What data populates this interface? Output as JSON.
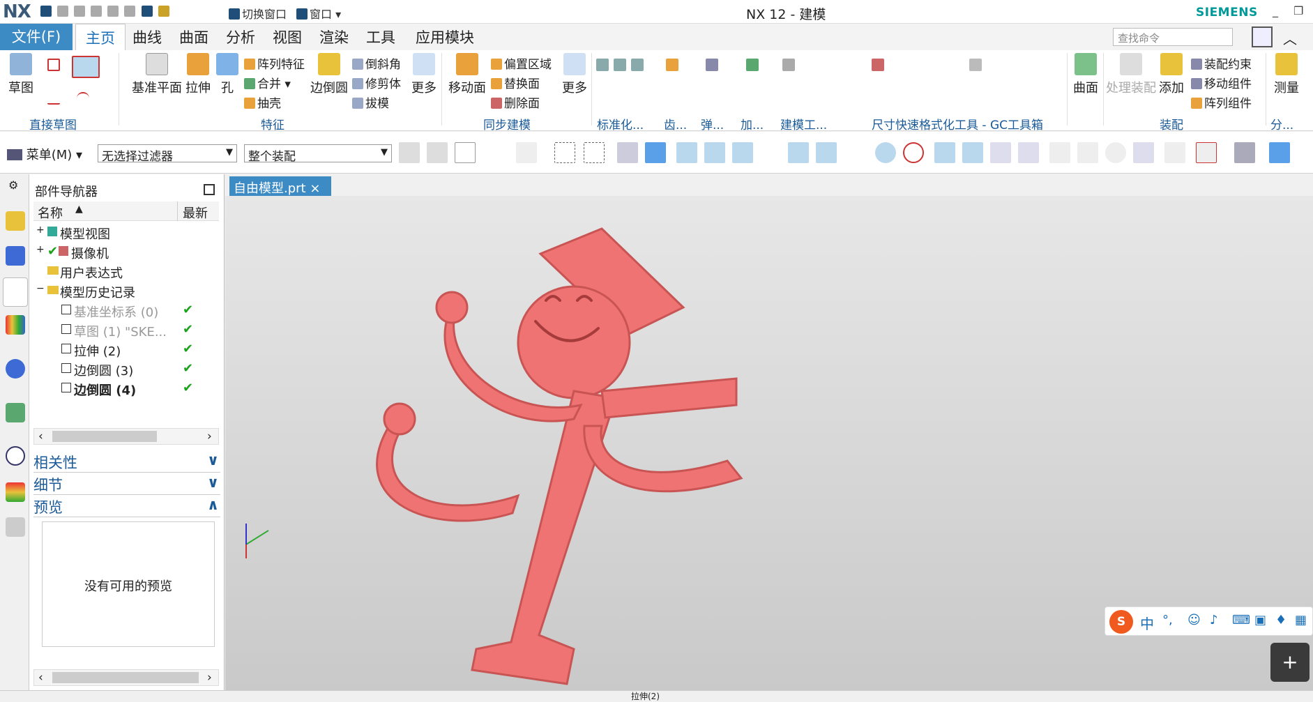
{
  "app": {
    "logo": "NX",
    "title": "NX 12 - 建模",
    "vendor": "SIEMENS"
  },
  "quick_access": {
    "switch_window": "切换窗口",
    "window": "窗口"
  },
  "tabs": {
    "file": "文件(F)",
    "items": [
      "主页",
      "曲线",
      "曲面",
      "分析",
      "视图",
      "渲染",
      "工具",
      "应用模块"
    ],
    "active": "主页"
  },
  "search": {
    "placeholder": "查找命令"
  },
  "ribbon": {
    "sketch": "草图",
    "groups": [
      "直接草图",
      "特征",
      "同步建模",
      "标准化...",
      "齿...",
      "弹...",
      "加...",
      "建模工...",
      "尺寸快速格式化工具 - GC工具箱",
      "装配",
      "分..."
    ],
    "feature": {
      "datum_plane": "基准平面",
      "extrude": "拉伸",
      "hole": "孔",
      "pattern": "阵列特征",
      "unite": "合并",
      "shell": "抽壳",
      "edge_blend": "边倒圆",
      "chamfer": "倒斜角",
      "trim": "修剪体",
      "draft": "拔模",
      "more": "更多"
    },
    "sync": {
      "move_face": "移动面",
      "offset_region": "偏置区域",
      "replace_face": "替换面",
      "delete_face": "删除面",
      "more": "更多"
    },
    "surface": "曲面",
    "assembly": {
      "process": "处理装配",
      "add": "添加",
      "constraint": "装配约束",
      "move_comp": "移动组件",
      "pattern_comp": "阵列组件",
      "measure": "测量"
    }
  },
  "toolbar2": {
    "menu": "菜单(M)",
    "filter": "无选择过滤器",
    "scope": "整个装配"
  },
  "navigator": {
    "title": "部件导航器",
    "col_name": "名称",
    "col_latest": "最新",
    "rows": [
      {
        "label": "模型视图",
        "dim": false,
        "check": ""
      },
      {
        "label": "摄像机",
        "dim": false,
        "check": ""
      },
      {
        "label": "用户表达式",
        "dim": false,
        "check": ""
      },
      {
        "label": "模型历史记录",
        "dim": false,
        "check": ""
      },
      {
        "label": "基准坐标系 (0)",
        "dim": true,
        "check": "✔"
      },
      {
        "label": "草图 (1) \"SKE...",
        "dim": true,
        "check": "✔"
      },
      {
        "label": "拉伸 (2)",
        "dim": false,
        "check": "✔"
      },
      {
        "label": "边倒圆 (3)",
        "dim": false,
        "check": "✔"
      },
      {
        "label": "边倒圆 (4)",
        "dim": false,
        "check": "✔"
      }
    ],
    "panels": [
      "相关性",
      "细节",
      "预览"
    ],
    "preview_empty": "没有可用的预览"
  },
  "document": {
    "tab": "自由模型.prt"
  },
  "status": {
    "text": "拉伸(2)"
  },
  "ime": {
    "mode": "中",
    "punct": "°,"
  },
  "colors": {
    "accent": "#3d8bc4",
    "model": "#ef7373"
  }
}
